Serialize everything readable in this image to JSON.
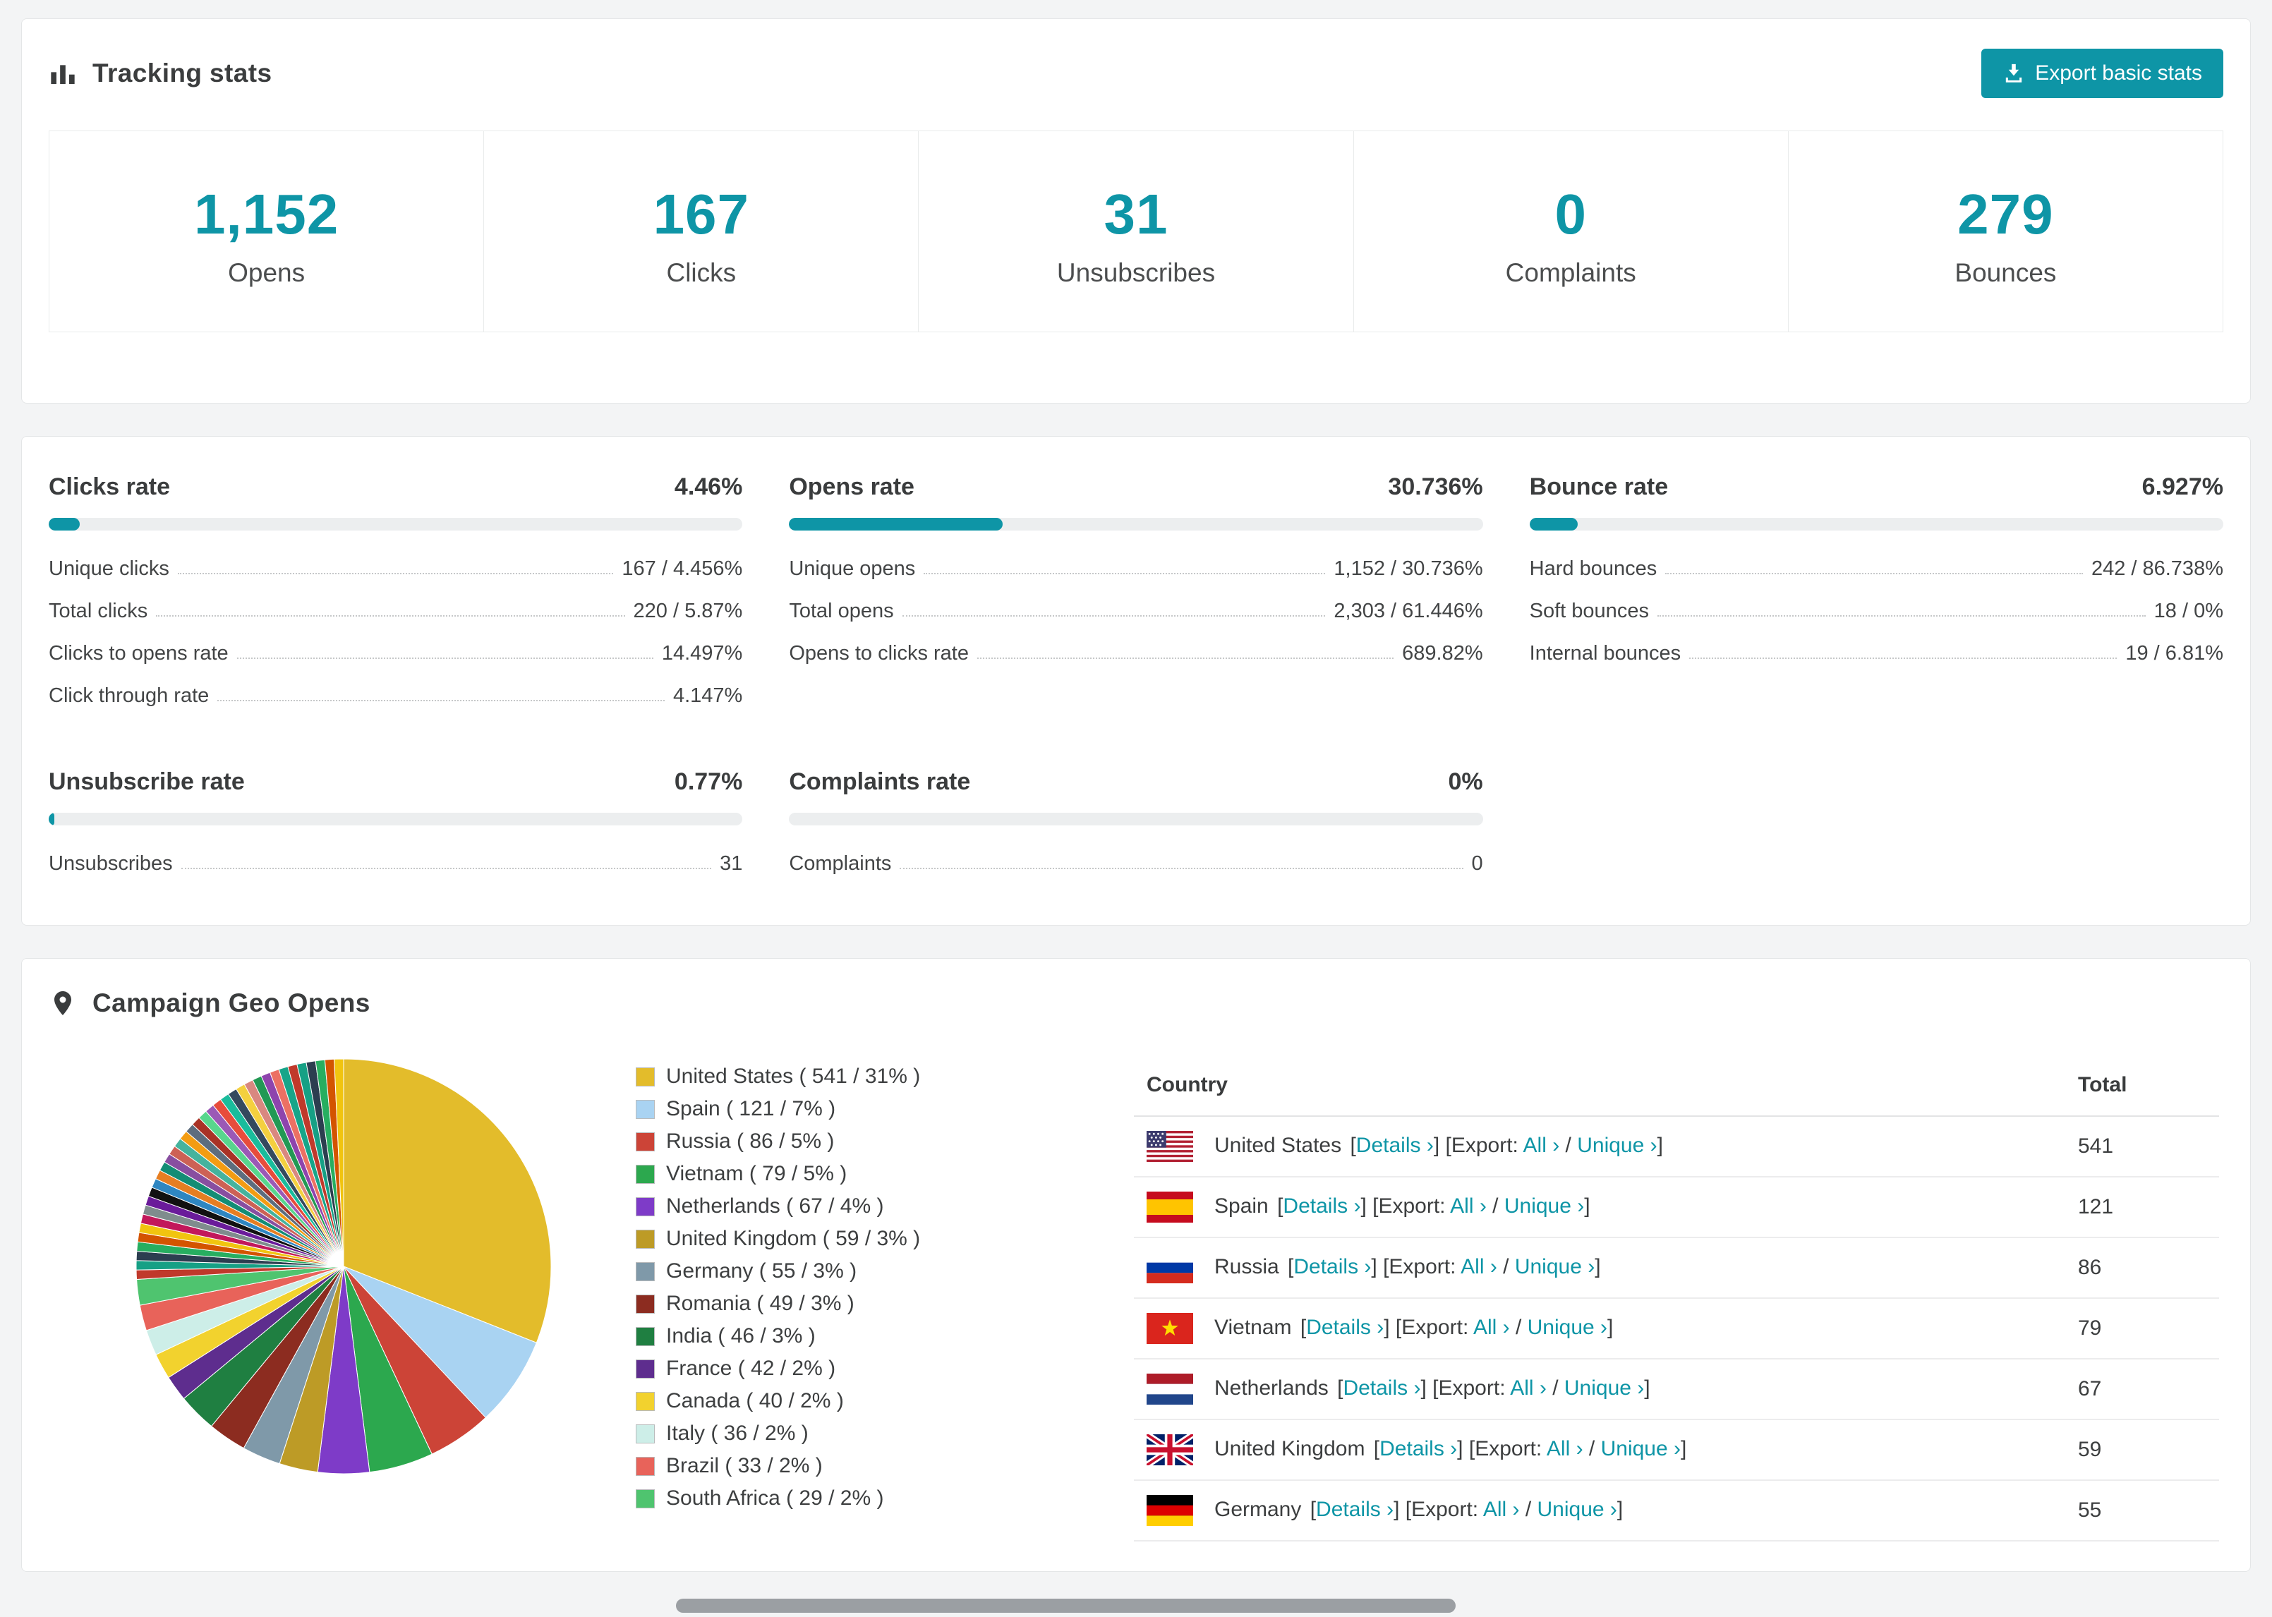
{
  "accent_color": "#0e95a6",
  "tracking": {
    "title": "Tracking stats",
    "export_button": "Export basic stats",
    "stats": [
      {
        "value": "1,152",
        "label": "Opens"
      },
      {
        "value": "167",
        "label": "Clicks"
      },
      {
        "value": "31",
        "label": "Unsubscribes"
      },
      {
        "value": "0",
        "label": "Complaints"
      },
      {
        "value": "279",
        "label": "Bounces"
      }
    ]
  },
  "rates": [
    {
      "title": "Clicks rate",
      "value": "4.46%",
      "percent": 4.46,
      "rows": [
        {
          "label": "Unique clicks",
          "value": "167 / 4.456%"
        },
        {
          "label": "Total clicks",
          "value": "220 / 5.87%"
        },
        {
          "label": "Clicks to opens rate",
          "value": "14.497%"
        },
        {
          "label": "Click through rate",
          "value": "4.147%"
        }
      ]
    },
    {
      "title": "Opens rate",
      "value": "30.736%",
      "percent": 30.736,
      "rows": [
        {
          "label": "Unique opens",
          "value": "1,152 / 30.736%"
        },
        {
          "label": "Total opens",
          "value": "2,303 / 61.446%"
        },
        {
          "label": "Opens to clicks rate",
          "value": "689.82%"
        }
      ]
    },
    {
      "title": "Bounce rate",
      "value": "6.927%",
      "percent": 6.927,
      "rows": [
        {
          "label": "Hard bounces",
          "value": "242 / 86.738%"
        },
        {
          "label": "Soft bounces",
          "value": "18 / 0%"
        },
        {
          "label": "Internal bounces",
          "value": "19 / 6.81%"
        }
      ]
    },
    {
      "title": "Unsubscribe rate",
      "value": "0.77%",
      "percent": 0.77,
      "rows": [
        {
          "label": "Unsubscribes",
          "value": "31"
        }
      ]
    },
    {
      "title": "Complaints rate",
      "value": "0%",
      "percent": 0,
      "rows": [
        {
          "label": "Complaints",
          "value": "0"
        }
      ]
    }
  ],
  "geo": {
    "title": "Campaign Geo Opens",
    "table": {
      "col_country": "Country",
      "col_total": "Total",
      "details_label": "Details ›",
      "export_label": "Export:",
      "all_label": "All ›",
      "unique_label": "Unique ›",
      "rows": [
        {
          "country": "United States",
          "total": "541",
          "flag": "us"
        },
        {
          "country": "Spain",
          "total": "121",
          "flag": "es"
        },
        {
          "country": "Russia",
          "total": "86",
          "flag": "ru"
        },
        {
          "country": "Vietnam",
          "total": "79",
          "flag": "vn"
        },
        {
          "country": "Netherlands",
          "total": "67",
          "flag": "nl"
        },
        {
          "country": "United Kingdom",
          "total": "59",
          "flag": "gb"
        },
        {
          "country": "Germany",
          "total": "55",
          "flag": "de"
        }
      ]
    },
    "chart_data": {
      "type": "pie",
      "title": "Campaign Geo Opens",
      "labels": [
        "United States",
        "Spain",
        "Russia",
        "Vietnam",
        "Netherlands",
        "United Kingdom",
        "Germany",
        "Romania",
        "India",
        "France",
        "Canada",
        "Italy",
        "Brazil",
        "South Africa"
      ],
      "values": [
        541,
        121,
        86,
        79,
        67,
        59,
        55,
        49,
        46,
        42,
        40,
        36,
        33,
        29
      ],
      "percents": [
        31,
        7,
        5,
        5,
        4,
        3,
        3,
        3,
        3,
        2,
        2,
        2,
        2,
        2
      ],
      "colors": [
        "#e3bc2b",
        "#a9d3f2",
        "#cc4437",
        "#2ca84e",
        "#7e3bc8",
        "#bd9b26",
        "#7f99a9",
        "#8c2c20",
        "#1f7f41",
        "#5e2d8e",
        "#f2d22e",
        "#cdeee8",
        "#e8635a",
        "#4fc46f"
      ],
      "legend_format": "{label} ( {value} / {percent}% )",
      "others": {
        "percent": 26,
        "slice_count": 36
      },
      "others_palette": [
        "#c0392b",
        "#16a085",
        "#2c3e50",
        "#27ae60",
        "#d35400",
        "#f1c40f",
        "#c2185b",
        "#7f8c8d",
        "#6a1b9a",
        "#111111",
        "#2e86c1",
        "#e67e22",
        "#138d75",
        "#884ea0",
        "#cd6155",
        "#45b39d",
        "#f39c12",
        "#5d6d7e",
        "#a93226",
        "#58d68d",
        "#9b59b6",
        "#e74c3c",
        "#1abc9c",
        "#34495e",
        "#f4d03f",
        "#d98880",
        "#229954",
        "#8e44ad",
        "#ec7063",
        "#17a589"
      ]
    }
  }
}
